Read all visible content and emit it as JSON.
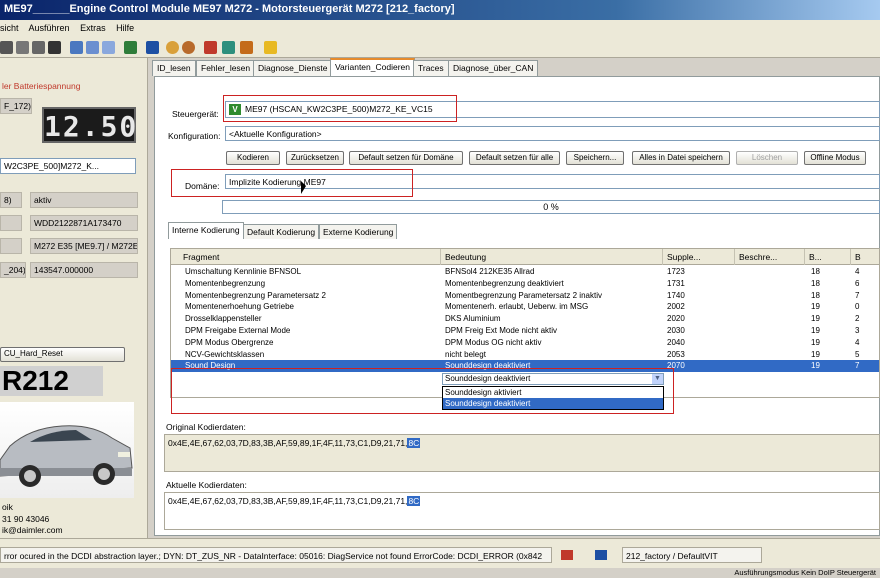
{
  "window": {
    "title": "ME97______Engine Control Module ME97 M272 - Motorsteuergerät M272 [212_factory]"
  },
  "menu": [
    "sicht",
    "Ausführen",
    "Extras",
    "Hilfe"
  ],
  "colors": {
    "accent": "#316ac5",
    "highlight_red": "#cc2222",
    "titlebar": "#0a246a"
  },
  "left_panel": {
    "warning": "ler Batteriespannung",
    "id_field": "F_172)",
    "lcd_value": "12.50",
    "variant_field": "W2C3PE_500]M272_K...",
    "rows": [
      {
        "label": "8)",
        "value": "aktiv"
      },
      {
        "label": "",
        "value": "WDD2122871A173470"
      },
      {
        "label": "",
        "value": "M272 E35 [ME9.7] / M272E"
      },
      {
        "label": "_204)",
        "value": "143547.000000"
      }
    ],
    "reset_button": "CU_Hard_Reset",
    "model": "R212",
    "contact_name": "oik",
    "contact_phone": "31 90 43046",
    "contact_email": "ik@daimler.com"
  },
  "tabs": [
    {
      "label": "ID_lesen",
      "selected": false
    },
    {
      "label": "Fehler_lesen",
      "selected": false
    },
    {
      "label": "Diagnose_Dienste",
      "selected": false
    },
    {
      "label": "Varianten_Codieren",
      "selected": true
    },
    {
      "label": "Traces",
      "selected": false
    },
    {
      "label": "Diagnose_über_CAN",
      "selected": false
    }
  ],
  "form": {
    "steuergeraet_label": "Steuergerät:",
    "steuergeraet_badge": "V",
    "steuergeraet_value": "ME97 (HSCAN_KW2C3PE_500)M272_KE_VC15",
    "konfiguration_label": "Konfiguration:",
    "konfiguration_value": "<Aktuelle Konfiguration>",
    "domaene_label": "Domäne:",
    "domaene_value": "Implizite Kodierung ME97",
    "progress": "0 %"
  },
  "buttons": [
    {
      "label": "Kodieren",
      "enabled": true
    },
    {
      "label": "Zurücksetzen",
      "enabled": true
    },
    {
      "label": "Default setzen für Domäne",
      "enabled": true
    },
    {
      "label": "Default setzen für alle",
      "enabled": true
    },
    {
      "label": "Speichern...",
      "enabled": true
    },
    {
      "label": "Alles in Datei speichern",
      "enabled": true
    },
    {
      "label": "Löschen",
      "enabled": false
    },
    {
      "label": "Offline Modus",
      "enabled": true
    }
  ],
  "subtabs": [
    {
      "label": "Interne Kodierung",
      "selected": true
    },
    {
      "label": "Default Kodierung",
      "selected": false
    },
    {
      "label": "Externe Kodierung",
      "selected": false
    }
  ],
  "grid": {
    "columns": [
      "Fragment",
      "Bedeutung",
      "Supple...",
      "Beschre...",
      "B...",
      "B"
    ],
    "rows": [
      [
        "Umschaltung Kennlinie BFNSOL",
        "BFNSol4 212KE35 Allrad",
        "1723",
        "",
        "18",
        "4"
      ],
      [
        "Momentenbegrenzung",
        "Momentenbegrenzung deaktiviert",
        "1731",
        "",
        "18",
        "6"
      ],
      [
        "Momentenbegrenzung Parametersatz 2",
        "Momentbegrenzung Parametersatz 2 inaktiv",
        "1740",
        "",
        "18",
        "7"
      ],
      [
        "Momentenerhoehung Getriebe",
        "Momentenerh. erlaubt, Ueberw. im MSG",
        "2002",
        "",
        "19",
        "0"
      ],
      [
        "Drosselklappensteller",
        "DKS Aluminium",
        "2020",
        "",
        "19",
        "2"
      ],
      [
        "DPM Freigabe External Mode",
        "DPM Freig Ext Mode nicht aktiv",
        "2030",
        "",
        "19",
        "3"
      ],
      [
        "DPM Modus Obergrenze",
        "DPM Modus OG nicht aktiv",
        "2040",
        "",
        "19",
        "4"
      ],
      [
        "NCV-Gewichtsklassen",
        "nicht belegt",
        "2053",
        "",
        "19",
        "5"
      ],
      [
        "Sound Design",
        "Sounddesign deaktiviert",
        "2070",
        "",
        "19",
        "7"
      ]
    ],
    "selected_row": 8
  },
  "dropdown": {
    "current": "Sounddesign deaktiviert",
    "options": [
      "Sounddesign aktiviert",
      "Sounddesign deaktiviert"
    ],
    "selected_option": 1
  },
  "original_kodierdaten": {
    "label": "Original Kodierdaten:",
    "value": "0x4E,4E,67,62,03,7D,83,3B,AF,59,89,1F,4F,11,73,C1,D9,21,71,",
    "highlight": "8C"
  },
  "aktuelle_kodierdaten": {
    "label": "Aktuelle Kodierdaten:",
    "value": "0x4E,4E,67,62,03,7D,83,3B,AF,59,89,1F,4F,11,73,C1,D9,21,71,",
    "highlight": "8C"
  },
  "status": {
    "message": "rror ocured in the DCDI abstraction layer.; DYN: DT_ZUS_NR - DataInterface: 05016: DiagService not found ErrorCode: DCDI_ERROR  (0x842",
    "profile": "212_factory / DefaultVIT",
    "mode": "Ausführungsmodus  Kein DoIP Steuergerät"
  }
}
